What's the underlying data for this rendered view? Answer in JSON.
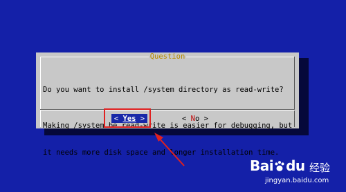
{
  "dialog": {
    "title": "Question",
    "line1": "Do you want to install /system directory as read-write?",
    "line2": "Making /system be read-write is easier for debugging, but",
    "line3": "it needs more disk space and longer installation time.",
    "yes_label": "Yes",
    "no_hot": "N",
    "no_rest": "o"
  },
  "watermark": {
    "logo_bai": "Bai",
    "logo_du": "du",
    "brand_cn": "经验",
    "url": "jingyan.baidu.com"
  },
  "colors": {
    "background": "#1420a8",
    "dialog": "#c8c8c8",
    "selected_button": "#1828a8",
    "annotation": "#e02020"
  }
}
